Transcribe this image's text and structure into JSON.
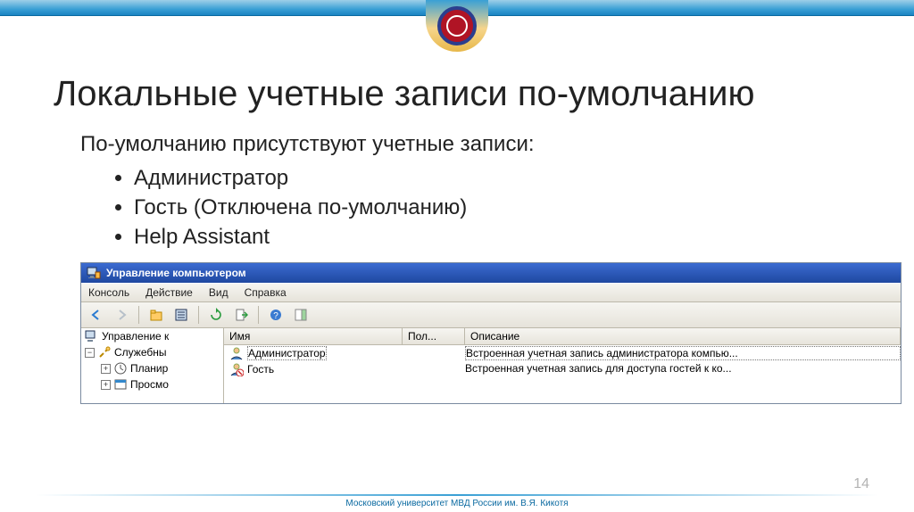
{
  "slide": {
    "title": "Локальные учетные записи по-умолчанию",
    "subtitle": "По-умолчанию присутствуют учетные записи:",
    "bullets": [
      "Администратор",
      "Гость (Отключена по-умолчанию)",
      "Help Assistant"
    ],
    "page_number": "14",
    "footer": "Московский университет МВД России им. В.Я. Кикотя"
  },
  "mmc": {
    "title": "Управление компьютером",
    "menu": {
      "console": "Консоль",
      "action": "Действие",
      "view": "Вид",
      "help": "Справка"
    },
    "tree": {
      "root": "Управление к",
      "services": "Служебны",
      "scheduler": "Планир",
      "viewer": "Просмо"
    },
    "list": {
      "cols": {
        "name": "Имя",
        "full": "Пол...",
        "desc": "Описание"
      },
      "rows": [
        {
          "name": "Администратор",
          "full": "",
          "desc": "Встроенная учетная запись администратора компью..."
        },
        {
          "name": "Гость",
          "full": "",
          "desc": "Встроенная учетная запись для доступа гостей к ко..."
        }
      ]
    }
  }
}
